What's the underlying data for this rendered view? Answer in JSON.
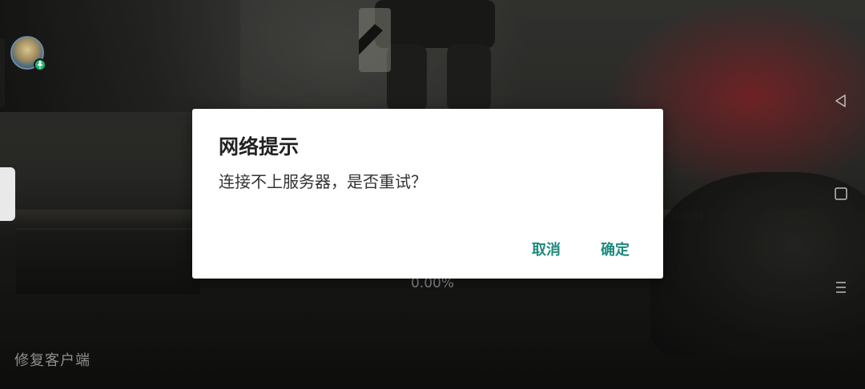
{
  "dialog": {
    "title": "网络提示",
    "message": "连接不上服务器，是否重试？",
    "cancel_label": "取消",
    "confirm_label": "确定",
    "button_color": "#1d8a7e"
  },
  "loading": {
    "progress_text": "0.00%"
  },
  "sidebar": {
    "repair_label": "修复客户端",
    "avatar_icon": "user-avatar",
    "mic_icon": "microphone-icon"
  },
  "navbar": {
    "back_icon": "triangle-back-icon",
    "home_icon": "square-home-icon",
    "menu_icon": "hamburger-menu-icon"
  }
}
